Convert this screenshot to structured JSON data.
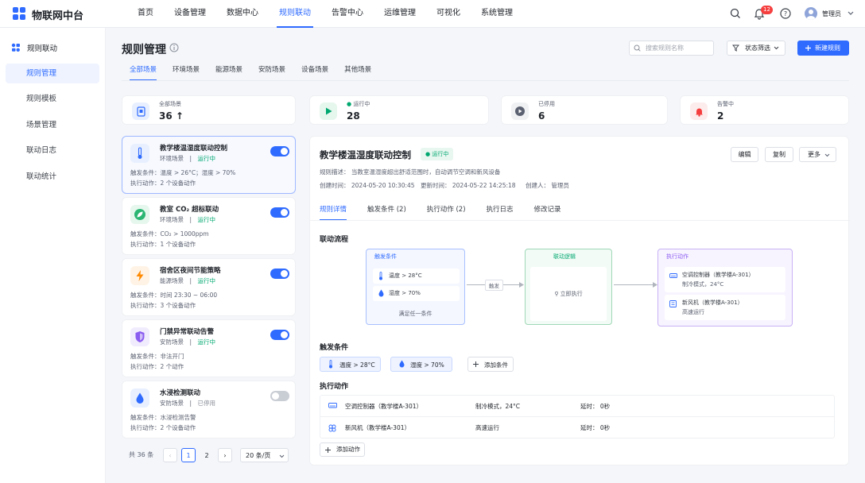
{
  "app": {
    "name": "物联网中台"
  },
  "nav": [
    "首页",
    "设备管理",
    "数据中心",
    "规则联动",
    "告警中心",
    "运维管理",
    "可视化",
    "系统管理"
  ],
  "topbar": {
    "notification_count": "12",
    "user": "管理员"
  },
  "sidebar": {
    "title": "规则联动",
    "items": [
      {
        "label": "规则管理"
      },
      {
        "label": "规则模板"
      },
      {
        "label": "场景管理"
      },
      {
        "label": "联动日志"
      },
      {
        "label": "联动统计"
      }
    ]
  },
  "page": {
    "title": "规则管理",
    "search_placeholder": "搜索规则名称",
    "filter_label": "状态筛选",
    "new_button": "新建规则",
    "tabs": [
      "全部场景",
      "环境场景",
      "能源场景",
      "安防场景",
      "设备场景",
      "其他场景"
    ]
  },
  "stats": [
    {
      "label": "全部场景",
      "value": "36 ↑",
      "icon": "device-icon"
    },
    {
      "label": "运行中",
      "value": "28",
      "icon": "play-icon"
    },
    {
      "label": "已停用",
      "value": "6",
      "icon": "pause-icon"
    },
    {
      "label": "告警中",
      "value": "2",
      "icon": "bell-icon"
    }
  ],
  "rules": [
    {
      "name": "教学楼温湿度联动控制",
      "scene": "环境场景",
      "status": "运行中",
      "trigger": "触发条件：温度 > 26°C；湿度 > 70%",
      "action": "执行动作：2 个设备动作",
      "enabled": true,
      "icon": "thermometer-icon"
    },
    {
      "name": "教室 CO₂ 超标联动",
      "scene": "环境场景",
      "status": "运行中",
      "trigger": "触发条件：CO₂ > 1000ppm",
      "action": "执行动作：1 个设备动作",
      "enabled": true,
      "icon": "leaf-icon"
    },
    {
      "name": "宿舍区夜间节能策略",
      "scene": "能源场景",
      "status": "运行中",
      "trigger": "触发条件：时间 23:30 ~ 06:00",
      "action": "执行动作：3 个设备动作",
      "enabled": true,
      "icon": "lightning-icon"
    },
    {
      "name": "门禁异常联动告警",
      "scene": "安防场景",
      "status": "运行中",
      "trigger": "触发条件：非法开门",
      "action": "执行动作：2 个动作",
      "enabled": true,
      "icon": "shield-icon"
    },
    {
      "name": "水浸检测联动",
      "scene": "安防场景",
      "status": "已停用",
      "trigger": "触发条件：水浸检测告警",
      "action": "执行动作：2 个设备动作",
      "enabled": false,
      "icon": "water-drop-icon"
    }
  ],
  "pagination": {
    "total": "共 36 条",
    "page1": "1",
    "page2": "2",
    "page_size": "20 条/页"
  },
  "detail": {
    "title": "教学楼温湿度联动控制",
    "status": "运行中",
    "buttons": {
      "edit": "编辑",
      "copy": "复制",
      "more": "更多"
    },
    "description": "规则描述：  当教室温湿度超出舒适范围时，自动调节空调和新风设备",
    "created": "创建时间：  2024-05-20 10:30:45",
    "updated": "更新时间：  2024-05-22 14:25:18",
    "creator": "创建人：  管理员",
    "tabs": [
      "规则详情",
      "触发条件 (2)",
      "执行动作 (2)",
      "执行日志",
      "修改记录"
    ],
    "flow": {
      "section": "联动流程",
      "trigger_head": "触发条件",
      "trigger_items": [
        "温度 > 28°C",
        "湿度 > 70%"
      ],
      "trigger_footer": "满足任一条件",
      "arrow_label": "触发",
      "logic_head": "联动逻辑",
      "logic_item": "立即执行",
      "action_head": "执行动作",
      "actions": [
        {
          "name": "空调控制器（教学楼A-301）",
          "detail": "制冷模式，24°C"
        },
        {
          "name": "新风机（教学楼A-301）",
          "detail": "高速运行"
        }
      ]
    },
    "conditions": {
      "section": "触发条件",
      "chips": [
        "温度 > 28°C",
        "湿度 > 70%"
      ],
      "add": "添加条件"
    },
    "actions": {
      "section": "执行动作",
      "rows": [
        {
          "device": "空调控制器（教学楼A-301）",
          "param": "制冷模式，24°C",
          "delay": "延时：  0秒"
        },
        {
          "device": "新风机（教学楼A-301）",
          "param": "高速运行",
          "delay": "延时：  0秒"
        }
      ],
      "add": "添加动作"
    }
  },
  "colors": {
    "primary": "#2f6bff",
    "success": "#00a870",
    "danger": "#f53f3f",
    "purple": "#8a5cf0"
  }
}
